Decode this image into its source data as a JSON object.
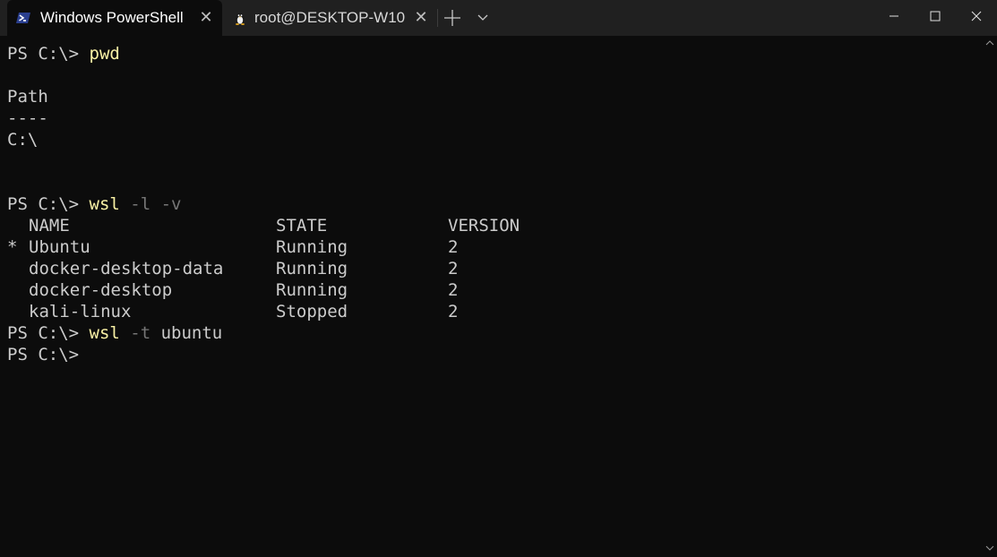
{
  "tabs": [
    {
      "label": "Windows PowerShell",
      "icon": "powershell-icon",
      "active": true
    },
    {
      "label": "root@DESKTOP-W10",
      "icon": "linux-penguin-icon",
      "active": false
    }
  ],
  "tab_close_glyph": "✕",
  "titlebar": {
    "new_tab_icon": "plus-icon",
    "dropdown_icon": "chevron-down-icon",
    "minimize_icon": "minimize-icon",
    "maximize_icon": "maximize-icon",
    "close_icon": "close-icon"
  },
  "terminal": {
    "prompt": "PS C:\\> ",
    "lines": {
      "cmd1": {
        "command": "pwd"
      },
      "path_header": "Path",
      "path_rule": "----",
      "path_value": "C:\\",
      "cmd2": {
        "command": "wsl",
        "flags": " -l -v"
      },
      "cmd3": {
        "command": "wsl",
        "flags": " -t",
        "arg": " ubuntu"
      }
    },
    "table": {
      "headers": [
        "NAME",
        "STATE",
        "VERSION"
      ],
      "rows": [
        {
          "marker": "*",
          "name": "Ubuntu",
          "state": "Running",
          "version": "2"
        },
        {
          "marker": "",
          "name": "docker-desktop-data",
          "state": "Running",
          "version": "2"
        },
        {
          "marker": "",
          "name": "docker-desktop",
          "state": "Running",
          "version": "2"
        },
        {
          "marker": "",
          "name": "kali-linux",
          "state": "Stopped",
          "version": "2"
        }
      ]
    }
  },
  "colors": {
    "background": "#0c0c0c",
    "tabbar": "#202020",
    "command": "#f9f1a5",
    "flag": "#767676",
    "text": "#cccccc",
    "powershell_blue": "#2a3f8f"
  }
}
